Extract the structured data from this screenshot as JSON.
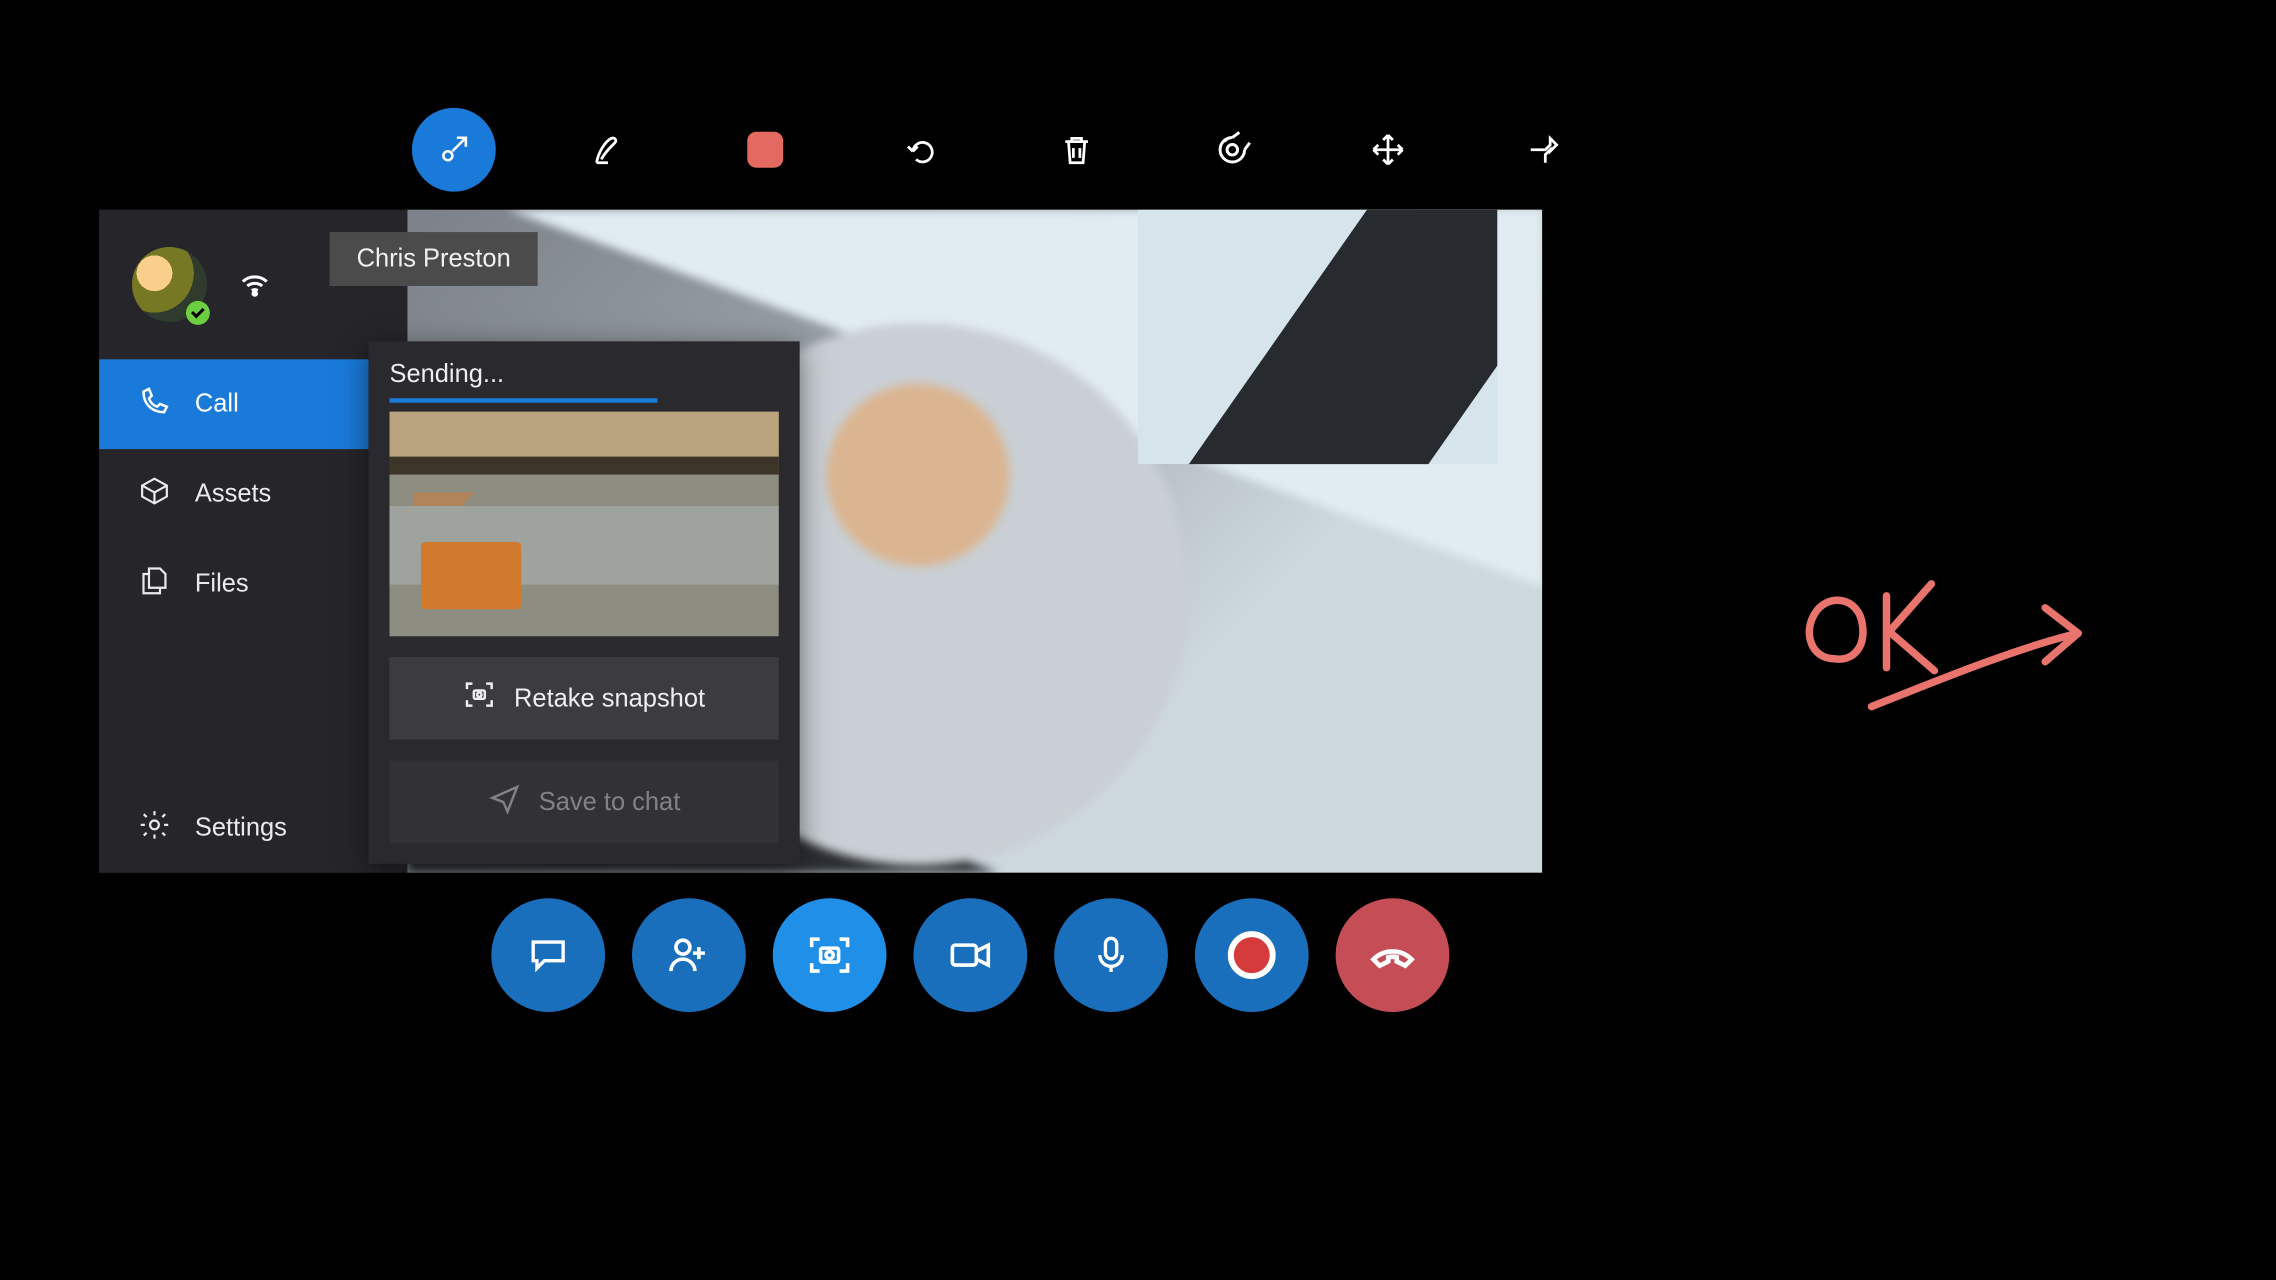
{
  "toolbar": {
    "icons": [
      {
        "name": "shrink-icon",
        "state": "active"
      },
      {
        "name": "draw-icon",
        "state": ""
      },
      {
        "name": "stop-icon",
        "state": ""
      },
      {
        "name": "undo-icon",
        "state": ""
      },
      {
        "name": "trash-icon",
        "state": ""
      },
      {
        "name": "target-icon",
        "state": ""
      },
      {
        "name": "move-arrows-icon",
        "state": ""
      },
      {
        "name": "pin-icon",
        "state": ""
      }
    ]
  },
  "call": {
    "participant_name": "Chris Preston"
  },
  "sidebar": {
    "items": [
      "Call",
      "Assets",
      "Files",
      "Settings"
    ],
    "active_index": 0
  },
  "snapshot": {
    "status": "Sending...",
    "progress_pct": 62,
    "retake_label": "Retake snapshot",
    "save_label": "Save to chat"
  },
  "call_controls": {
    "buttons": [
      "chat",
      "add-person",
      "snapshot",
      "video",
      "mic",
      "record",
      "end-call"
    ]
  },
  "annotation": {
    "text": "OK"
  },
  "colors": {
    "accent": "#1a7ad9",
    "danger": "#c54d55",
    "ink": "#e9746d"
  }
}
